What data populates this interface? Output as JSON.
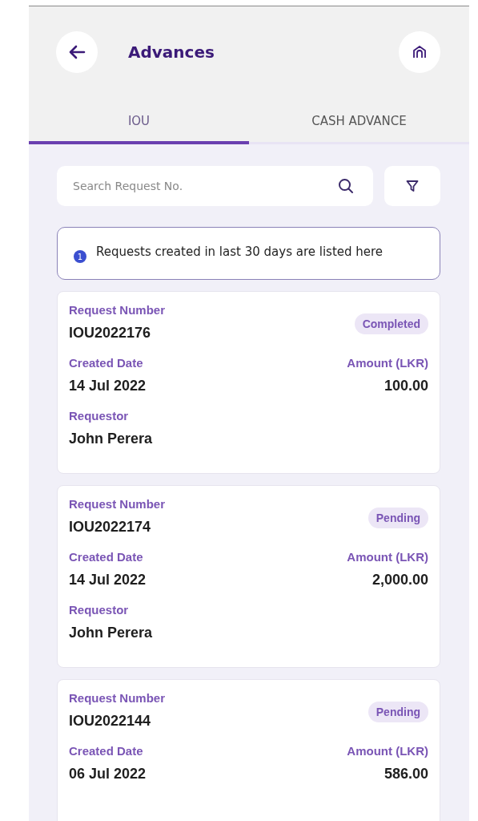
{
  "header": {
    "title": "Advances"
  },
  "tabs": [
    {
      "label": "IOU",
      "selected": true
    },
    {
      "label": "CASH ADVANCE",
      "selected": false
    }
  ],
  "search": {
    "placeholder": "Search Request No."
  },
  "info": {
    "badge": "1",
    "text": "Requests created in last 30 days are listed here"
  },
  "requests": [
    {
      "number_label": "Request Number",
      "number": "IOU2022176",
      "status": "Completed",
      "date_label": "Created Date",
      "date": "14 Jul 2022",
      "amount_label": "Amount (LKR)",
      "amount": "100.00",
      "requestor_label": "Requestor",
      "requestor": "John Perera"
    },
    {
      "number_label": "Request Number",
      "number": "IOU2022174",
      "status": "Pending",
      "date_label": "Created Date",
      "date": "14 Jul 2022",
      "amount_label": "Amount (LKR)",
      "amount": "2,000.00",
      "requestor_label": "Requestor",
      "requestor": "John Perera"
    },
    {
      "number_label": "Request Number",
      "number": "IOU2022144",
      "status": "Pending",
      "date_label": "Created Date",
      "date": "06 Jul 2022",
      "amount_label": "Amount (LKR)",
      "amount": "586.00"
    }
  ]
}
